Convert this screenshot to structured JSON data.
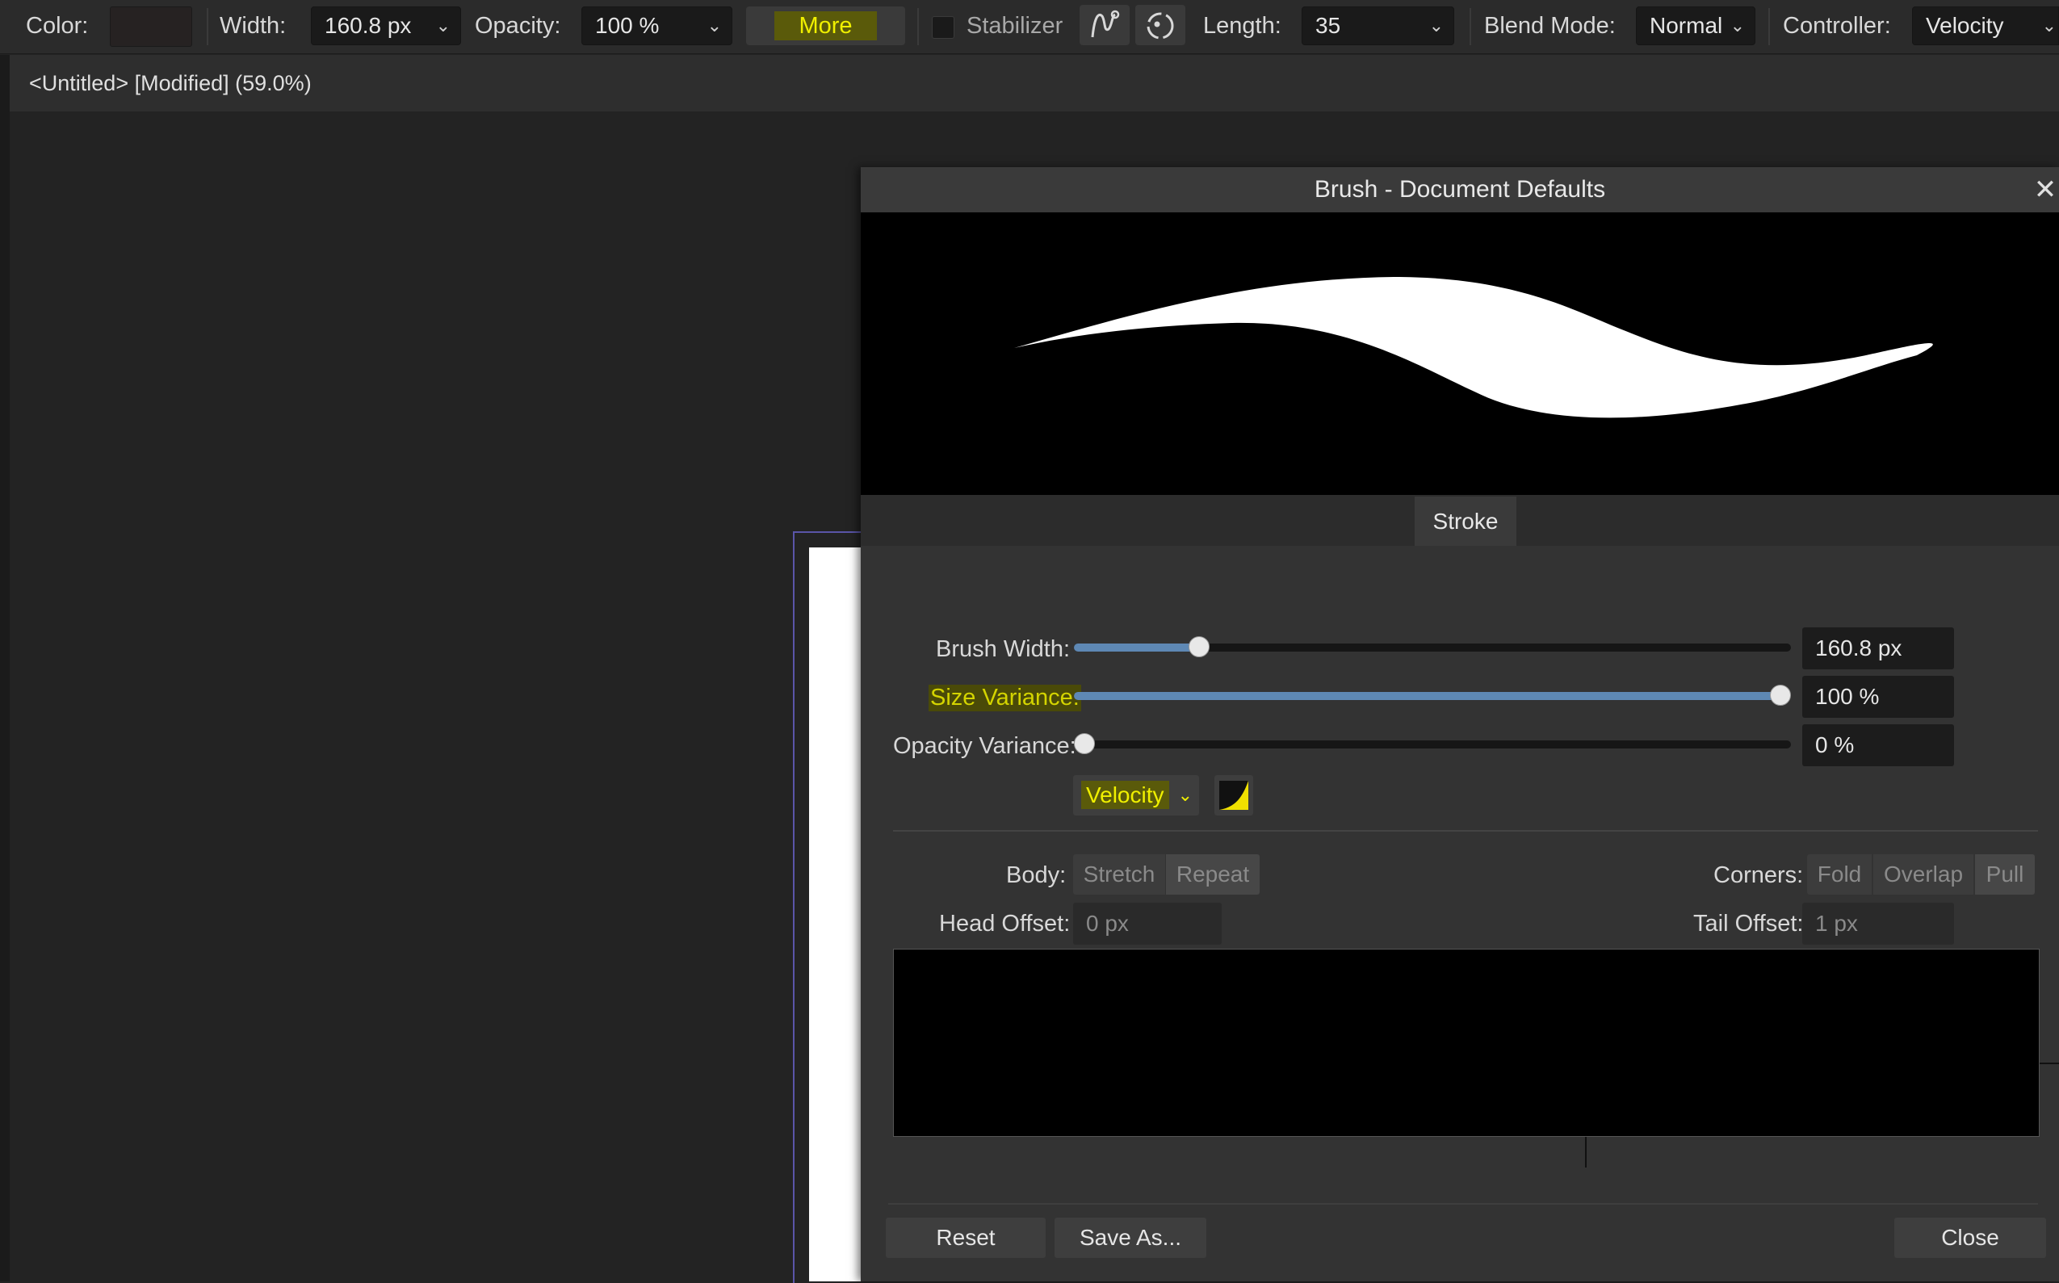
{
  "toolbar": {
    "color_label": "Color:",
    "color_value": "#262222",
    "width_label": "Width:",
    "width_value": "160.8 px",
    "opacity_label": "Opacity:",
    "opacity_value": "100 %",
    "more_label": "More",
    "stabilizer_label": "Stabilizer",
    "length_label": "Length:",
    "length_value": "35",
    "blend_label": "Blend Mode:",
    "blend_value": "Normal",
    "controller_label": "Controller:",
    "controller_value": "Velocity"
  },
  "document": {
    "tab_title": "<Untitled> [Modified] (59.0%)"
  },
  "dialog": {
    "title": "Brush - Document Defaults",
    "tab": "Stroke",
    "brush_width_label": "Brush Width:",
    "brush_width_value": "160.8 px",
    "brush_width_fraction": 0.165,
    "size_variance_label": "Size Variance:",
    "size_variance_value": "100 %",
    "size_variance_fraction": 1.0,
    "opacity_variance_label": "Opacity Variance:",
    "opacity_variance_value": "0 %",
    "opacity_variance_fraction": 0.0,
    "controller_value": "Velocity",
    "body_label": "Body:",
    "body_options": [
      "Stretch",
      "Repeat"
    ],
    "corners_label": "Corners:",
    "corners_options": [
      "Fold",
      "Overlap",
      "Pull"
    ],
    "head_offset_label": "Head Offset:",
    "head_offset_value": "0 px",
    "tail_offset_label": "Tail Offset:",
    "tail_offset_value": "1 px",
    "reset_label": "Reset",
    "save_as_label": "Save As...",
    "close_label": "Close"
  },
  "colors": {
    "highlight": "#f0f000",
    "slider_fill": "#5e88b4"
  }
}
